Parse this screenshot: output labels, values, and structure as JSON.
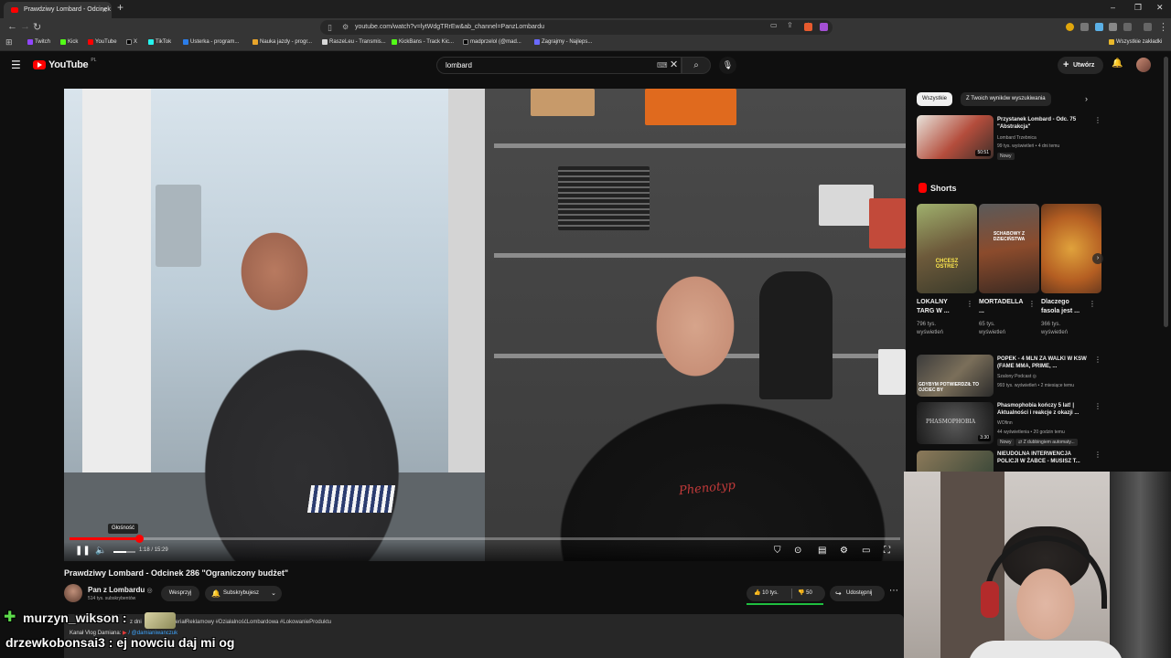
{
  "browser": {
    "tab_title": "Prawdziwy Lombard - Odcinek",
    "url": "youtube.com/watch?v=lytWdgTRrEw&ab_channel=PanzLombardu",
    "bookmarks": [
      "Twitch",
      "Kick",
      "YouTube",
      "X",
      "TikTok",
      "Usterka - program...",
      "Nauka jazdy - progr...",
      "RaszeLeu - Transmis...",
      "KickBans - Track Kic...",
      "madprzelol (@mad...",
      "Zagrajmy - Najleps..."
    ],
    "all_bookmarks": "Wszystkie zakładki",
    "colors": {
      "tabbar": "#1f1f1f",
      "toolbar": "#353535"
    }
  },
  "youtube": {
    "logo": "YouTube",
    "logo_country": "PL",
    "search_value": "lombard",
    "create_label": "Utwórz",
    "brand_color": "#ff0000"
  },
  "player": {
    "tooltip": "Głośność",
    "time_current": "1:18",
    "time_sep": " / ",
    "time_total": "15:29",
    "progress_fraction": 0.084,
    "volume_fraction": 0.6,
    "shirt_logo": "Phenotyp"
  },
  "video": {
    "title": "Prawdziwy Lombard - Odcinek 286 \"Ograniczony budżet\"",
    "channel": "Pan z Lombardu",
    "verified": "◎",
    "subscribers": "514 tys. subskrybentów",
    "support_label": "Wesprzyj",
    "subscribed_label": "Subskrybujesz",
    "likes": "10 tys.",
    "dislikes": "50",
    "share_label": "Udostępnij",
    "description_prefix": "z dni",
    "description_tags": "teriałReklamowy #DziałalnośćLombardowa #LokowanieProduktu",
    "description_line2": "Kanał Vlog Damiana: ",
    "description_link": "/ @damianiwanczuk",
    "like_color": "#1fbf3f"
  },
  "chat": {
    "line1_user": "murzyn_wikson",
    "line1_text": " : ",
    "line2_user": "drzewkobonsai3",
    "line2_text": " : ej nowciu daj mi og"
  },
  "sidebar": {
    "chips": [
      "Wszystkie",
      "Z Twoich wyników wyszukiwania"
    ],
    "top_video": {
      "title": "Przystanek Lombard - Odc. 75 \"Abstrakcja\"",
      "channel": "Lombard Trzebnica",
      "meta": "99 tys. wyświetleń • 4 dni temu",
      "badge": "Nowy",
      "duration": "50:51"
    },
    "shorts_heading": "Shorts",
    "shorts": [
      {
        "title": "LOKALNY TARG W ...",
        "views": "796 tys.",
        "views_label": "wyświetleń",
        "overlay": "CHCESZ OSTRE?"
      },
      {
        "title": "MORTADELLA ...",
        "views": "65 tys.",
        "views_label": "wyświetleń",
        "overlay": "SCHABOWY Z DZIECIŃSTWA"
      },
      {
        "title": "Dlaczego fasola jest ...",
        "views": "366 tys.",
        "views_label": "wyświetleń",
        "overlay": ""
      }
    ],
    "videos": [
      {
        "title": "POPEK - 4 MLN ZA WALKI W KSW (FAME MMA, PRIME, ...",
        "channel": "Szalony Podcast",
        "meta": "993 tys. wyświetleń • 2 miesiące temu",
        "badge": "",
        "duration": "",
        "overlay": "GDYBYM POTWIERDZIŁ TO OJCIEC BY"
      },
      {
        "title": "Phasmophobia kończy 5 lat! | Aktualności i reakcje z okazji ...",
        "channel": "WOfinn",
        "meta": "44 wyświetlenia • 20 godzin temu",
        "badge": "Nowy",
        "badge2": "Z dubbingiem automaty...",
        "duration": "3:30",
        "overlay": "PHASMOPHOBIA"
      },
      {
        "title": "NIEUDOLNA INTERWENCJA POLICJI W ŻABCE - MUSISZ T...",
        "channel": "",
        "meta": "",
        "badge": "",
        "duration": "",
        "overlay": ""
      }
    ]
  }
}
